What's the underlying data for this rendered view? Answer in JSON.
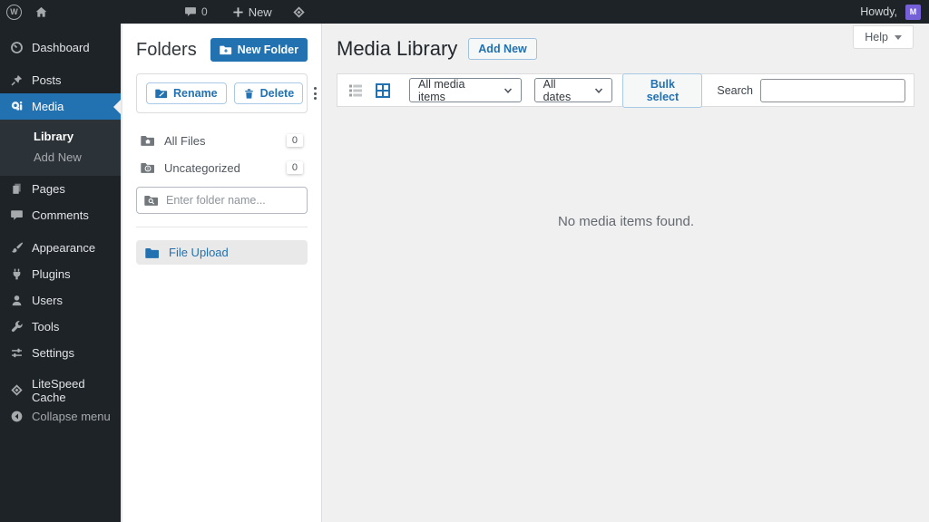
{
  "admin_bar": {
    "wp_logo_letter": "W",
    "comments_count": "0",
    "new_label": "New",
    "howdy_label": "Howdy,",
    "avatar_letter": "M"
  },
  "sidebar": {
    "items": [
      {
        "label": "Dashboard"
      },
      {
        "label": "Posts"
      },
      {
        "label": "Media"
      },
      {
        "label": "Pages"
      },
      {
        "label": "Comments"
      },
      {
        "label": "Appearance"
      },
      {
        "label": "Plugins"
      },
      {
        "label": "Users"
      },
      {
        "label": "Tools"
      },
      {
        "label": "Settings"
      },
      {
        "label": "LiteSpeed Cache"
      },
      {
        "label": "Collapse menu"
      }
    ],
    "media_submenu": [
      {
        "label": "Library"
      },
      {
        "label": "Add New"
      }
    ]
  },
  "folders_panel": {
    "title": "Folders",
    "new_folder_button": "New Folder",
    "rename_button": "Rename",
    "delete_button": "Delete",
    "folders": [
      {
        "name": "All Files",
        "count": "0"
      },
      {
        "name": "Uncategorized",
        "count": "0"
      }
    ],
    "folder_input_placeholder": "Enter folder name...",
    "upload_label": "File Upload"
  },
  "main": {
    "title": "Media Library",
    "add_new_button": "Add New",
    "help_label": "Help",
    "toolbar": {
      "media_type_filter": "All media items",
      "date_filter": "All dates",
      "bulk_select_button": "Bulk select",
      "search_label": "Search"
    },
    "empty_message": "No media items found."
  },
  "colors": {
    "accent_blue": "#2271b1",
    "admin_bar_bg": "#1d2327",
    "sidebar_bg": "#1d2327",
    "submenu_bg": "#2c3338",
    "content_bg": "#f0f0f1",
    "panel_bg": "#ffffff",
    "selected_row_bg": "#e9e9ea",
    "avatar_purple": "#7560d8"
  }
}
